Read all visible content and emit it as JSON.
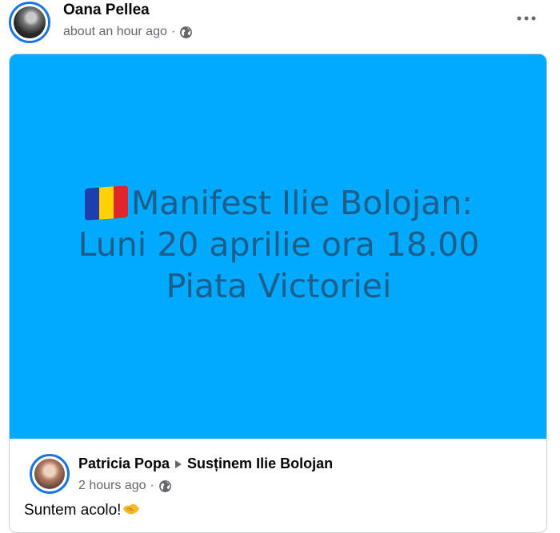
{
  "post": {
    "author": "Oana Pellea",
    "timestamp": "about an hour ago",
    "separator": "·",
    "privacy_icon": "globe-icon",
    "menu_icon": "more-horizontal-icon"
  },
  "shared_media": {
    "background_color": "#00aaff",
    "text_color": "#1e5d8a",
    "flag": "romania-flag-emoji",
    "line1": "Manifest Ilie  Bolojan:",
    "line2": "Luni 20 aprilie ora 18.00",
    "line3": "Piata Victoriei"
  },
  "shared_post": {
    "author": "Patricia Popa",
    "group": "Susținem Ilie Bolojan",
    "timestamp": "2 hours ago",
    "separator": "·",
    "privacy_icon": "globe-icon",
    "text": "Suntem acolo!",
    "emoji": "handshake-emoji"
  },
  "colors": {
    "accent": "#1b74e4",
    "secondary_text": "#65676b"
  }
}
